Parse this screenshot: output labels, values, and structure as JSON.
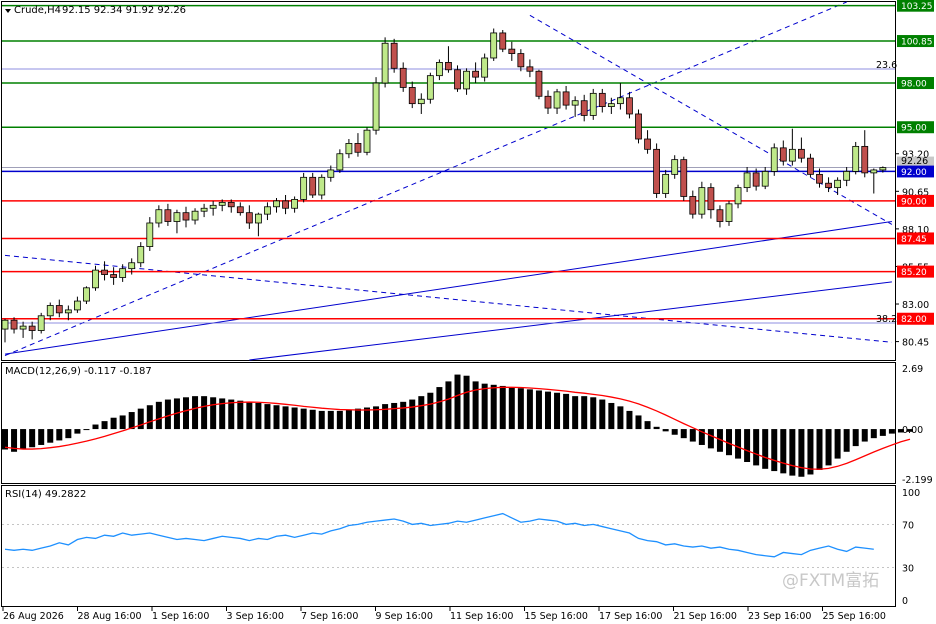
{
  "header": {
    "symbol_label": "Crude,H4",
    "ohlc": "92.15 92.34 91.92 92.26"
  },
  "macd": {
    "label": "MACD(12,26,9) -0.117 -0.187",
    "ticks": [
      "2.69",
      "0.00",
      "-2.199"
    ]
  },
  "rsi": {
    "label": "RSI(14) 49.2822",
    "ticks": [
      "100",
      "70",
      "30",
      "0"
    ]
  },
  "price_axis": {
    "ticks": [
      "93.20",
      "90.65",
      "88.10",
      "85.55",
      "83.00",
      "80.45"
    ],
    "level_tags": [
      "103.25",
      "100.85",
      "98.00",
      "95.00",
      "92.00",
      "90.00",
      "87.45",
      "85.20",
      "82.00"
    ],
    "current_price": "92.26"
  },
  "fib_labels": [
    "23.6",
    "38.2"
  ],
  "time_axis": [
    "26 Aug 2026",
    "28 Aug 16:00",
    "1 Sep 16:00",
    "3 Sep 16:00",
    "7 Sep 16:00",
    "9 Sep 16:00",
    "11 Sep 16:00",
    "15 Sep 16:00",
    "17 Sep 16:00",
    "21 Sep 16:00",
    "23 Sep 16:00",
    "25 Sep 16:00"
  ],
  "watermark": "@FXTM富拓",
  "colors": {
    "support_resistance_green": "#008000",
    "support_red": "#ff0000",
    "trendline_blue": "#0000cd",
    "candle_up": "#bfe98a",
    "candle_down": "#c0504d",
    "macd_signal": "#ff0000",
    "rsi_line": "#1e90ff",
    "current_price_tag": "#0000cd"
  },
  "chart_data": [
    {
      "type": "candlestick",
      "title": "Crude,H4",
      "ylim": [
        79.2,
        103.5
      ],
      "levels": {
        "resistance_green": [
          103.25,
          100.85,
          98.0,
          95.0
        ],
        "current_blue": [
          92.0
        ],
        "support_red": [
          90.0,
          87.45,
          85.2,
          82.0
        ]
      },
      "candles": [
        [
          81.3,
          82.0,
          80.4,
          81.9
        ],
        [
          81.9,
          82.1,
          81.0,
          81.3
        ],
        [
          81.3,
          81.8,
          80.7,
          81.5
        ],
        [
          81.5,
          81.8,
          80.6,
          81.2
        ],
        [
          81.2,
          82.4,
          81.0,
          82.2
        ],
        [
          82.2,
          83.1,
          81.9,
          82.9
        ],
        [
          82.9,
          83.3,
          82.1,
          82.4
        ],
        [
          82.4,
          82.9,
          81.9,
          82.6
        ],
        [
          82.6,
          83.5,
          82.4,
          83.2
        ],
        [
          83.2,
          84.2,
          83.0,
          84.1
        ],
        [
          84.1,
          85.6,
          83.9,
          85.3
        ],
        [
          85.3,
          85.9,
          84.6,
          85.0
        ],
        [
          85.0,
          85.5,
          84.3,
          84.8
        ],
        [
          84.8,
          85.7,
          84.5,
          85.4
        ],
        [
          85.4,
          86.1,
          85.0,
          85.8
        ],
        [
          85.8,
          87.2,
          85.5,
          86.9
        ],
        [
          86.9,
          88.9,
          86.6,
          88.5
        ],
        [
          88.5,
          89.7,
          88.2,
          89.4
        ],
        [
          89.4,
          89.8,
          88.3,
          88.6
        ],
        [
          88.6,
          89.4,
          87.8,
          89.2
        ],
        [
          89.2,
          89.6,
          88.2,
          88.7
        ],
        [
          88.7,
          89.5,
          88.4,
          89.3
        ],
        [
          89.3,
          89.8,
          88.9,
          89.5
        ],
        [
          89.5,
          90.0,
          89.0,
          89.7
        ],
        [
          89.7,
          90.1,
          89.3,
          89.9
        ],
        [
          89.9,
          90.1,
          89.2,
          89.6
        ],
        [
          89.6,
          89.9,
          89.0,
          89.2
        ],
        [
          89.2,
          89.7,
          88.1,
          88.5
        ],
        [
          88.5,
          89.2,
          87.6,
          89.1
        ],
        [
          89.1,
          89.9,
          88.7,
          89.6
        ],
        [
          89.6,
          90.2,
          89.2,
          90.0
        ],
        [
          90.0,
          90.4,
          89.1,
          89.5
        ],
        [
          89.5,
          90.3,
          89.2,
          90.1
        ],
        [
          90.1,
          91.9,
          89.9,
          91.6
        ],
        [
          91.6,
          91.9,
          90.2,
          90.4
        ],
        [
          90.4,
          91.8,
          90.1,
          91.6
        ],
        [
          91.6,
          92.4,
          91.3,
          92.1
        ],
        [
          92.1,
          93.5,
          91.9,
          93.2
        ],
        [
          93.2,
          94.2,
          92.9,
          93.9
        ],
        [
          93.9,
          94.6,
          93.0,
          93.3
        ],
        [
          93.3,
          95.0,
          93.1,
          94.8
        ],
        [
          94.8,
          98.4,
          94.5,
          98.0
        ],
        [
          98.0,
          101.1,
          97.7,
          100.7
        ],
        [
          100.7,
          101.0,
          98.7,
          99.0
        ],
        [
          99.0,
          99.4,
          97.4,
          97.7
        ],
        [
          97.7,
          98.1,
          96.3,
          96.6
        ],
        [
          96.6,
          97.3,
          95.9,
          96.9
        ],
        [
          96.9,
          98.7,
          96.6,
          98.5
        ],
        [
          98.5,
          99.6,
          98.2,
          99.4
        ],
        [
          99.4,
          100.5,
          98.7,
          98.9
        ],
        [
          98.9,
          99.2,
          97.4,
          97.6
        ],
        [
          97.6,
          99.0,
          97.2,
          98.8
        ],
        [
          98.8,
          99.4,
          98.0,
          98.4
        ],
        [
          98.4,
          100.0,
          98.1,
          99.7
        ],
        [
          99.7,
          101.7,
          99.5,
          101.4
        ],
        [
          101.4,
          101.6,
          100.1,
          100.3
        ],
        [
          100.3,
          100.8,
          99.5,
          100.0
        ],
        [
          100.0,
          100.3,
          98.8,
          99.1
        ],
        [
          99.1,
          99.6,
          98.4,
          98.8
        ],
        [
          98.8,
          98.9,
          96.9,
          97.1
        ],
        [
          97.1,
          97.5,
          95.9,
          96.3
        ],
        [
          96.3,
          97.6,
          95.9,
          97.4
        ],
        [
          97.4,
          97.8,
          96.2,
          96.5
        ],
        [
          96.5,
          97.1,
          95.7,
          96.8
        ],
        [
          96.8,
          97.2,
          95.4,
          95.8
        ],
        [
          95.8,
          97.6,
          95.5,
          97.3
        ],
        [
          97.3,
          97.6,
          96.0,
          96.4
        ],
        [
          96.4,
          97.0,
          95.9,
          96.6
        ],
        [
          96.6,
          98.0,
          96.2,
          97.0
        ],
        [
          97.0,
          97.4,
          95.6,
          95.9
        ],
        [
          95.9,
          96.2,
          93.9,
          94.2
        ],
        [
          94.2,
          94.8,
          93.2,
          93.5
        ],
        [
          93.5,
          93.9,
          90.2,
          90.5
        ],
        [
          90.5,
          92.1,
          90.2,
          91.8
        ],
        [
          91.8,
          93.1,
          91.5,
          92.8
        ],
        [
          92.8,
          93.0,
          90.0,
          90.3
        ],
        [
          90.3,
          90.7,
          88.8,
          89.1
        ],
        [
          89.1,
          91.3,
          88.8,
          90.9
        ],
        [
          90.9,
          91.2,
          88.8,
          89.4
        ],
        [
          89.4,
          89.7,
          88.2,
          88.6
        ],
        [
          88.6,
          90.0,
          88.3,
          89.8
        ],
        [
          89.8,
          91.1,
          89.5,
          90.9
        ],
        [
          90.9,
          92.3,
          90.6,
          91.9
        ],
        [
          91.9,
          92.2,
          90.7,
          91.0
        ],
        [
          91.0,
          92.3,
          90.8,
          92.0
        ],
        [
          92.0,
          93.9,
          91.7,
          93.6
        ],
        [
          93.6,
          94.1,
          92.4,
          92.7
        ],
        [
          92.7,
          94.9,
          92.4,
          93.5
        ],
        [
          93.5,
          94.3,
          92.6,
          92.9
        ],
        [
          92.9,
          93.2,
          91.6,
          91.8
        ],
        [
          91.8,
          92.2,
          90.9,
          91.2
        ],
        [
          91.2,
          91.6,
          90.6,
          90.9
        ],
        [
          90.9,
          91.6,
          90.4,
          91.4
        ],
        [
          91.4,
          92.3,
          91.0,
          92.0
        ],
        [
          92.0,
          94.0,
          91.8,
          93.7
        ],
        [
          93.7,
          94.8,
          91.6,
          91.9
        ],
        [
          91.9,
          92.2,
          90.5,
          92.1
        ],
        [
          92.1,
          92.34,
          91.92,
          92.26
        ]
      ]
    },
    {
      "type": "bar",
      "title": "MACD(12,26,9) -0.117 -0.187",
      "ylim": [
        -2.199,
        2.69
      ],
      "series": [
        {
          "name": "MACD",
          "kind": "histogram",
          "values": [
            -0.9,
            -1.0,
            -0.9,
            -0.8,
            -0.7,
            -0.6,
            -0.5,
            -0.4,
            -0.2,
            0.0,
            0.2,
            0.35,
            0.5,
            0.6,
            0.75,
            0.9,
            1.05,
            1.2,
            1.3,
            1.35,
            1.4,
            1.45,
            1.45,
            1.4,
            1.35,
            1.3,
            1.25,
            1.2,
            1.15,
            1.1,
            1.05,
            1.0,
            0.95,
            0.9,
            0.85,
            0.8,
            0.8,
            0.8,
            0.85,
            0.9,
            0.95,
            1.0,
            1.1,
            1.15,
            1.2,
            1.3,
            1.45,
            1.6,
            1.85,
            2.1,
            2.4,
            2.35,
            2.1,
            2.0,
            1.95,
            1.9,
            1.85,
            1.8,
            1.75,
            1.7,
            1.65,
            1.6,
            1.55,
            1.45,
            1.45,
            1.4,
            1.3,
            1.15,
            1.0,
            0.8,
            0.6,
            0.35,
            0.1,
            -0.1,
            -0.25,
            -0.4,
            -0.55,
            -0.7,
            -0.85,
            -1.0,
            -1.15,
            -1.3,
            -1.45,
            -1.6,
            -1.75,
            -1.85,
            -1.95,
            -2.05,
            -2.1,
            -2.0,
            -1.8,
            -1.6,
            -1.3,
            -1.0,
            -0.75,
            -0.55,
            -0.4,
            -0.3,
            -0.2,
            -0.15,
            -0.12
          ]
        },
        {
          "name": "Signal",
          "kind": "line",
          "values": [
            -0.8,
            -0.85,
            -0.88,
            -0.88,
            -0.86,
            -0.82,
            -0.77,
            -0.7,
            -0.62,
            -0.53,
            -0.43,
            -0.32,
            -0.2,
            -0.08,
            0.05,
            0.18,
            0.32,
            0.45,
            0.58,
            0.7,
            0.81,
            0.91,
            1.0,
            1.07,
            1.12,
            1.16,
            1.18,
            1.19,
            1.18,
            1.16,
            1.13,
            1.09,
            1.05,
            1.0,
            0.96,
            0.92,
            0.89,
            0.86,
            0.85,
            0.84,
            0.84,
            0.85,
            0.87,
            0.9,
            0.93,
            0.97,
            1.03,
            1.1,
            1.2,
            1.32,
            1.48,
            1.62,
            1.72,
            1.78,
            1.82,
            1.84,
            1.84,
            1.83,
            1.81,
            1.78,
            1.75,
            1.71,
            1.67,
            1.62,
            1.58,
            1.53,
            1.48,
            1.41,
            1.33,
            1.23,
            1.11,
            0.96,
            0.8,
            0.62,
            0.43,
            0.24,
            0.06,
            -0.12,
            -0.29,
            -0.46,
            -0.63,
            -0.79,
            -0.95,
            -1.1,
            -1.25,
            -1.38,
            -1.5,
            -1.61,
            -1.7,
            -1.76,
            -1.77,
            -1.73,
            -1.64,
            -1.51,
            -1.35,
            -1.18,
            -1.01,
            -0.85,
            -0.7,
            -0.56,
            -0.45
          ]
        }
      ]
    },
    {
      "type": "line",
      "title": "RSI(14) 49.2822",
      "ylim": [
        0,
        100
      ],
      "series": [
        {
          "name": "RSI(14)",
          "values": [
            47,
            46,
            47,
            46,
            48,
            50,
            53,
            51,
            56,
            58,
            57,
            60,
            59,
            62,
            60,
            61,
            62,
            60,
            58,
            56,
            57,
            56,
            55,
            57,
            59,
            58,
            57,
            55,
            57,
            56,
            59,
            60,
            58,
            60,
            62,
            61,
            64,
            66,
            69,
            70,
            72,
            73,
            74,
            75,
            73,
            70,
            71,
            69,
            70,
            71,
            73,
            72,
            74,
            76,
            78,
            80,
            76,
            72,
            73,
            75,
            74,
            73,
            70,
            71,
            69,
            70,
            68,
            66,
            64,
            62,
            57,
            55,
            54,
            51,
            52,
            50,
            49,
            50,
            48,
            49,
            47,
            46,
            44,
            42,
            41,
            40,
            44,
            43,
            42,
            46,
            48,
            50,
            47,
            45,
            49,
            48,
            47
          ]
        }
      ]
    }
  ]
}
